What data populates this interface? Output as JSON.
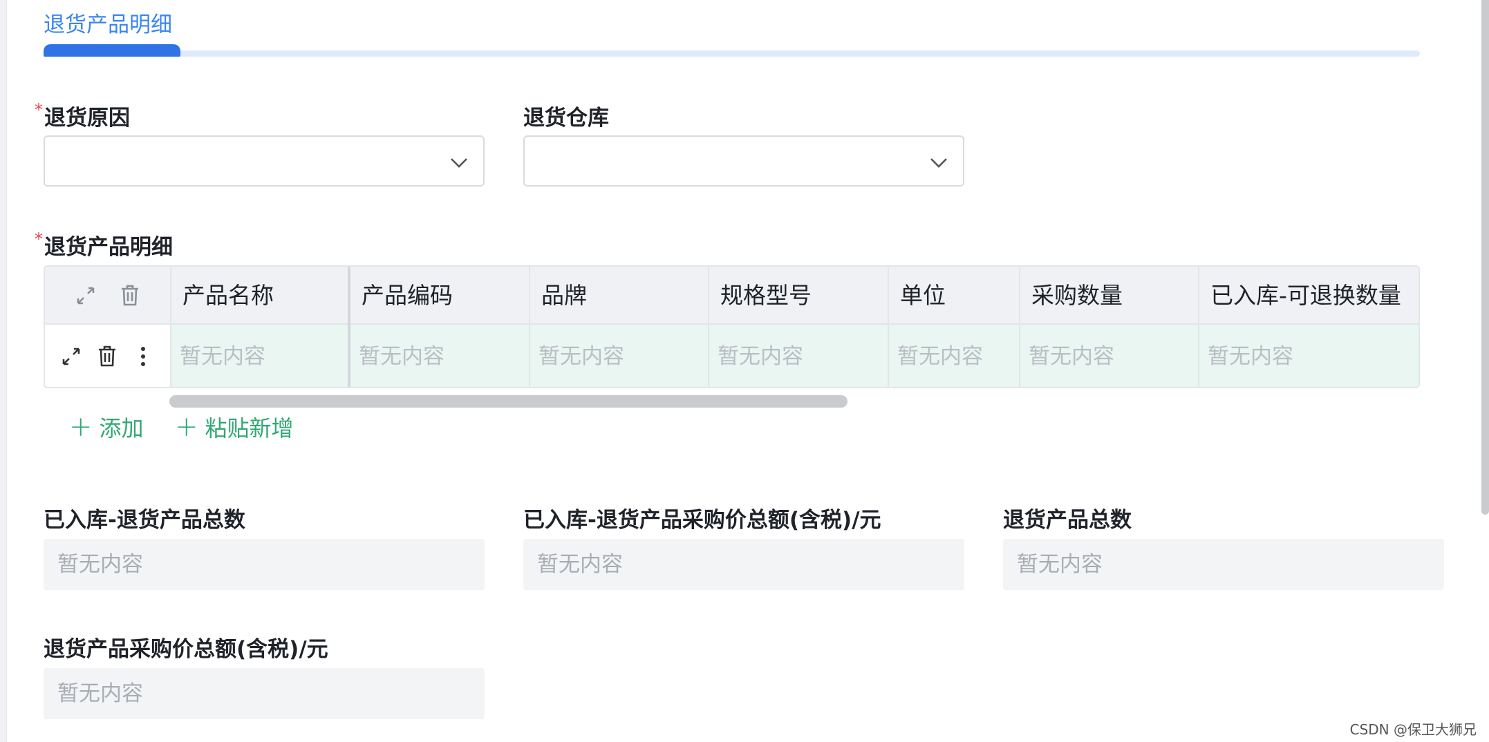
{
  "section": {
    "title": "退货产品明细"
  },
  "fields": {
    "return_reason": {
      "label": "退货原因",
      "required": true,
      "value": ""
    },
    "return_warehouse": {
      "label": "退货仓库",
      "required": false,
      "value": ""
    }
  },
  "detail_table": {
    "label": "退货产品明细",
    "required": true,
    "columns": [
      "产品名称",
      "产品编码",
      "品牌",
      "规格型号",
      "单位",
      "采购数量",
      "已入库-可退换数量"
    ],
    "rows": [
      [
        "暂无内容",
        "暂无内容",
        "暂无内容",
        "暂无内容",
        "暂无内容",
        "暂无内容",
        "暂无内容"
      ]
    ],
    "actions": {
      "add": "添加",
      "paste_add": "粘贴新增"
    }
  },
  "summary": {
    "stocked_total_count": {
      "label": "已入库-退货产品总数",
      "value": "暂无内容"
    },
    "stocked_total_amount": {
      "label": "已入库-退货产品采购价总额(含税)/元",
      "value": "暂无内容"
    },
    "return_total_count": {
      "label": "退货产品总数",
      "value": "暂无内容"
    },
    "return_total_amount": {
      "label": "退货产品采购价总额(含税)/元",
      "value": "暂无内容"
    }
  },
  "watermark": "CSDN @保卫大狮兄",
  "colors": {
    "accent_blue": "#2f73e6",
    "action_green": "#2fa872",
    "required_red": "#e5484d",
    "row_highlight": "#e9f6f1"
  }
}
